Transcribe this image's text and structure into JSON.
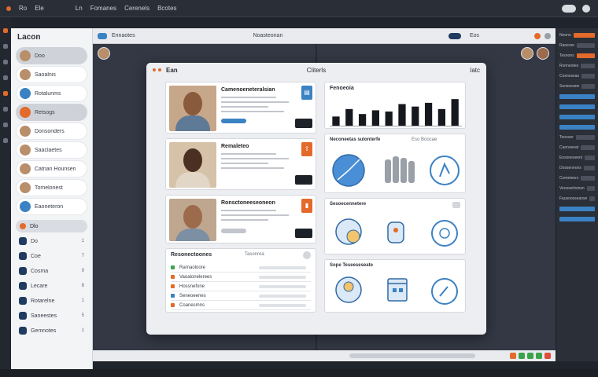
{
  "os_bar": {
    "items": [
      "Ro",
      "Ele",
      "Ln",
      "Fomanes",
      "Cerenels",
      "Bcotes"
    ]
  },
  "sidebar": {
    "title": "Lacon",
    "items": [
      {
        "label": "Doo",
        "avatar_color": "#b98e6a",
        "highlighted": true
      },
      {
        "label": "Saoalnis",
        "avatar_color": "#b98e6a"
      },
      {
        "label": "Rotalunms",
        "avatar_color": "#3b82c4"
      },
      {
        "label": "Retsogs",
        "avatar_color": "#e36a2b",
        "highlighted": true
      },
      {
        "label": "Donsonders",
        "avatar_color": "#b98e6a"
      },
      {
        "label": "Saaclaetes",
        "avatar_color": "#b98e6a"
      },
      {
        "label": "Catnan Hounsen",
        "avatar_color": "#b98e6a"
      },
      {
        "label": "Tomelonest",
        "avatar_color": "#b98e6a"
      },
      {
        "label": "Eaoneteron",
        "avatar_color": "#3b82c4"
      }
    ],
    "section": "Dlo",
    "plain_items": [
      {
        "label": "Do",
        "num": "1"
      },
      {
        "label": "Coe",
        "num": "7"
      },
      {
        "label": "Cosma",
        "num": "9"
      },
      {
        "label": "Lecare",
        "num": "8"
      },
      {
        "label": "Rotarelne",
        "num": "1"
      },
      {
        "label": "Saneestes",
        "num": "5"
      },
      {
        "label": "Gemnotes",
        "num": "1"
      }
    ]
  },
  "workspace": {
    "toolbar": {
      "crumb": "Ennaotes",
      "path": "Noasteonan",
      "right_label": "Eos"
    }
  },
  "dialog": {
    "left_label": "Ean",
    "center_label": "Cliterls",
    "right_label": "Iatc",
    "profiles": [
      {
        "name": "Camenoeneteralsian"
      },
      {
        "name": "Remaleteo"
      },
      {
        "name": "Ronsctoneeseoneon"
      }
    ],
    "chart": {
      "label": "Fenoeoia"
    },
    "chart_data": {
      "type": "bar",
      "categories": [
        "1",
        "2",
        "3",
        "4",
        "5",
        "6",
        "7",
        "8",
        "9",
        "10"
      ],
      "values": [
        8,
        14,
        10,
        13,
        12,
        18,
        16,
        19,
        14,
        22
      ],
      "ylim": [
        0,
        24
      ],
      "title": "Fenoeoia",
      "xlabel": "",
      "ylabel": ""
    },
    "icon_cards": [
      {
        "label": "Neconeetas sulonterfe",
        "sub": "Eso Boocae",
        "icons": [
          "pie-chart-icon",
          "people-icon",
          "hand-icon"
        ]
      },
      {
        "label": "Sesoecennetere",
        "sub": "",
        "icons": [
          "cloud-sync-icon",
          "hand-device-icon",
          "play-circle-icon"
        ]
      },
      {
        "label": "Sope Teseeseseate",
        "sub": "",
        "icons": [
          "person-desk-icon",
          "calendar-icon",
          "refresh-icon"
        ]
      }
    ],
    "list": {
      "label": "Resonectoones",
      "header2": "Tasonrea",
      "rows": [
        {
          "label": "Rarnaoloore",
          "color": "#3aa34a"
        },
        {
          "label": "Vaoalonelerees",
          "color": "#e36a2b"
        },
        {
          "label": "Hossnefone",
          "color": "#e36a2b"
        },
        {
          "label": "Seneoeenes",
          "color": "#3b82c4"
        },
        {
          "label": "Coanesmns",
          "color": "#e36a2b"
        }
      ]
    }
  },
  "right_panel": {
    "rows": [
      {
        "label": "Neono",
        "kind": "orange"
      },
      {
        "label": "Raneoer",
        "kind": "gray"
      },
      {
        "label": "Tesnoes",
        "kind": "orange"
      },
      {
        "label": "Ronneotes",
        "kind": "gray"
      },
      {
        "label": "Cosnoseas",
        "kind": "gray"
      },
      {
        "label": "Sooseeane",
        "kind": "gray"
      },
      {
        "label": "",
        "kind": "blue"
      },
      {
        "label": "",
        "kind": "blue"
      },
      {
        "label": "",
        "kind": "blue"
      },
      {
        "label": "",
        "kind": "blue"
      },
      {
        "label": "Teooser",
        "kind": "gray"
      },
      {
        "label": "Caonseeat",
        "kind": "gray"
      },
      {
        "label": "Ensoneseent",
        "kind": "gray"
      },
      {
        "label": "Dosseneons",
        "kind": "gray"
      },
      {
        "label": "Cometeers",
        "kind": "gray"
      },
      {
        "label": "Veosserbonsn",
        "kind": "gray"
      },
      {
        "label": "Fausoosseanse",
        "kind": "gray"
      },
      {
        "label": "",
        "kind": "blue"
      },
      {
        "label": "",
        "kind": "blue"
      }
    ]
  },
  "bottom_chips": [
    "#e36a2b",
    "#3aa34a",
    "#3aa34a",
    "#3aa34a",
    "#e04b3a"
  ]
}
